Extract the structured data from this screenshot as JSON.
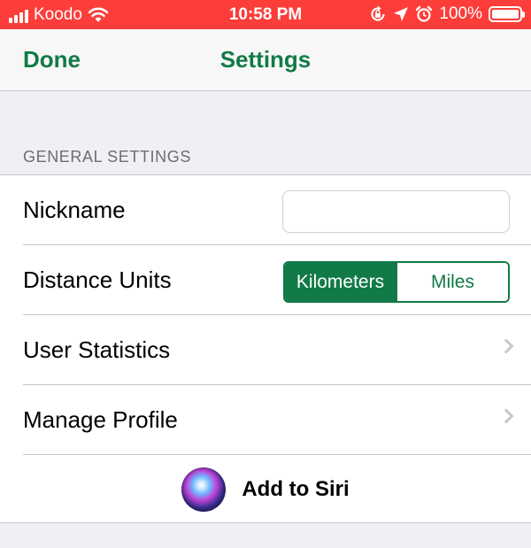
{
  "status_bar": {
    "carrier": "Koodo",
    "time": "10:58 PM",
    "battery": "100%",
    "icons": [
      "signal-icon",
      "wifi-icon",
      "rotation-lock-icon",
      "location-icon",
      "alarm-icon",
      "battery-icon"
    ]
  },
  "nav": {
    "done_label": "Done",
    "title": "Settings"
  },
  "section": {
    "header": "GENERAL SETTINGS"
  },
  "rows": {
    "nickname": {
      "label": "Nickname",
      "value": "",
      "placeholder": ""
    },
    "distance_units": {
      "label": "Distance Units",
      "options": [
        "Kilometers",
        "Miles"
      ],
      "selected": "Kilometers"
    },
    "user_statistics": {
      "label": "User Statistics"
    },
    "manage_profile": {
      "label": "Manage Profile"
    },
    "add_to_siri": {
      "label": "Add to Siri"
    }
  },
  "colors": {
    "accent": "#117a46",
    "status_bar": "#fc3d39",
    "background": "#efeff4"
  }
}
